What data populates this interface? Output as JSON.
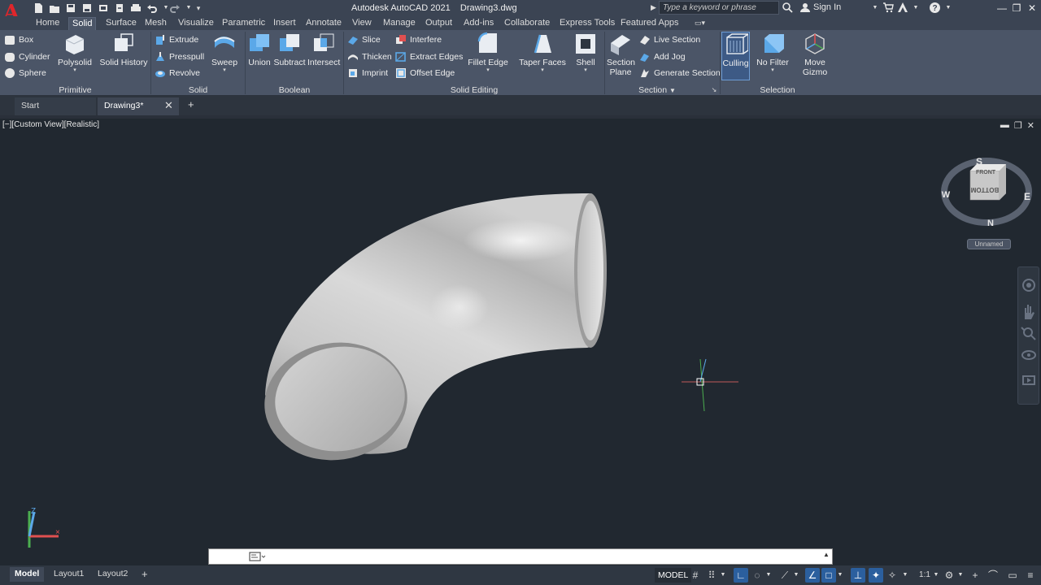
{
  "app": {
    "title": "Autodesk AutoCAD 2021    Drawing3.dwg",
    "logo_letter": "A",
    "search_placeholder": "Type a keyword or phrase",
    "sign_in": "Sign In"
  },
  "ribbon_tabs": [
    "Home",
    "Solid",
    "Surface",
    "Mesh",
    "Visualize",
    "Parametric",
    "Insert",
    "Annotate",
    "View",
    "Manage",
    "Output",
    "Add-ins",
    "Collaborate",
    "Express Tools",
    "Featured Apps"
  ],
  "active_tab": "Solid",
  "panels": {
    "primitive": {
      "title": "Primitive",
      "box": "Box",
      "cylinder": "Cylinder",
      "sphere": "Sphere",
      "polysolid": "Polysolid",
      "solid_history": "Solid History"
    },
    "solid": {
      "title": "Solid",
      "extrude": "Extrude",
      "presspull": "Presspull",
      "revolve": "Revolve",
      "sweep": "Sweep"
    },
    "boolean": {
      "title": "Boolean",
      "union": "Union",
      "subtract": "Subtract",
      "intersect": "Intersect"
    },
    "solid_editing": {
      "title": "Solid Editing",
      "slice": "Slice",
      "thicken": "Thicken",
      "imprint": "Imprint",
      "interfere": "Interfere",
      "extract_edges": "Extract Edges",
      "offset_edge": "Offset Edge",
      "fillet_edge": "Fillet Edge",
      "taper_faces": "Taper Faces",
      "shell": "Shell"
    },
    "section": {
      "title": "Section",
      "section_plane_1": "Section",
      "section_plane_2": "Plane",
      "live_section": "Live Section",
      "add_jog": "Add Jog",
      "generate_section": "Generate Section"
    },
    "selection": {
      "title": "Selection",
      "culling": "Culling",
      "no_filter": "No Filter",
      "move_gizmo_1": "Move",
      "move_gizmo_2": "Gizmo"
    }
  },
  "doc_tabs": {
    "start": "Start",
    "drawing": "Drawing3*"
  },
  "viewport": {
    "label": "[−][Custom View][Realistic]",
    "viewcube": {
      "top_face": "FRONT",
      "side_face": "BOTTOM",
      "north": "N",
      "south": "S",
      "east": "E",
      "west": "W"
    },
    "ucs_name": "Unnamed",
    "ucs_axis_z": "Z"
  },
  "command": {
    "value": ""
  },
  "status": {
    "model_tab": "Model",
    "layout1": "Layout1",
    "layout2": "Layout2",
    "space": "MODEL",
    "scale": "1:1"
  },
  "colors": {
    "ribbon_bg": "#4b5567",
    "titlebar_bg": "#3b4453",
    "viewport_bg": "#212830",
    "accent_blue": "#2b5f9e",
    "logo_red": "#e0262b"
  }
}
